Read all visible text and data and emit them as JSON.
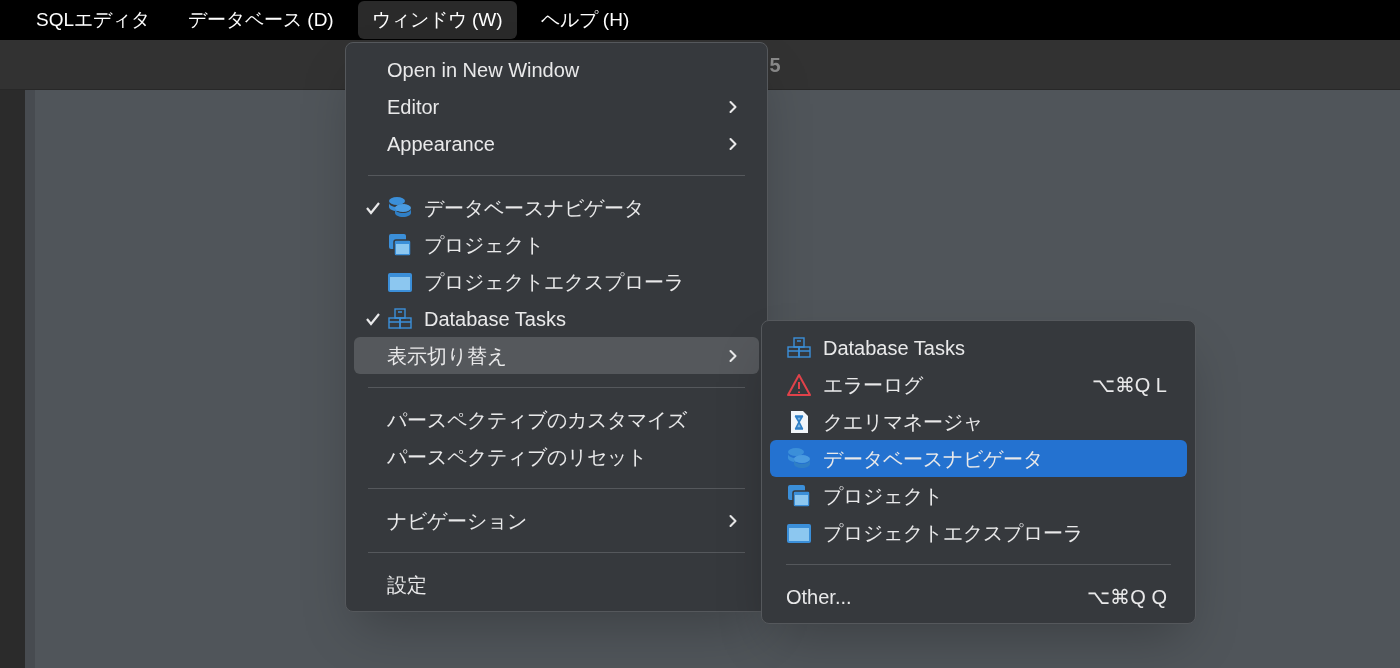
{
  "menu_bar": [
    {
      "label": "SQLエディタ",
      "selected": false
    },
    {
      "label": "データベース (D)",
      "selected": false
    },
    {
      "label": "ウィンドウ (W)",
      "selected": true
    },
    {
      "label": "ヘルプ (H)",
      "selected": false
    }
  ],
  "window": {
    "title": "5"
  },
  "window_menu": [
    {
      "kind": "text",
      "label": "Open in New Window",
      "checked": false,
      "selected": false,
      "submenu": false
    },
    {
      "kind": "text",
      "label": "Editor",
      "checked": false,
      "selected": false,
      "submenu": true
    },
    {
      "kind": "text",
      "label": "Appearance",
      "checked": false,
      "selected": false,
      "submenu": true
    },
    {
      "kind": "separator"
    },
    {
      "kind": "database",
      "label": "データベースナビゲータ",
      "checked": true,
      "selected": false,
      "submenu": false
    },
    {
      "kind": "windows",
      "label": "プロジェクト",
      "checked": false,
      "selected": false,
      "submenu": false
    },
    {
      "kind": "window",
      "label": "プロジェクトエクスプローラ",
      "checked": false,
      "selected": false,
      "submenu": false
    },
    {
      "kind": "boxes",
      "label": "Database Tasks",
      "checked": true,
      "selected": false,
      "submenu": false
    },
    {
      "kind": "text",
      "label": "表示切り替え",
      "checked": false,
      "selected": true,
      "submenu": true
    },
    {
      "kind": "separator"
    },
    {
      "kind": "text",
      "label": "パースペクティブのカスタマイズ",
      "checked": false,
      "selected": false,
      "submenu": false
    },
    {
      "kind": "text",
      "label": "パースペクティブのリセット",
      "checked": false,
      "selected": false,
      "submenu": false
    },
    {
      "kind": "separator"
    },
    {
      "kind": "text",
      "label": "ナビゲーション",
      "checked": false,
      "selected": false,
      "submenu": true
    },
    {
      "kind": "separator"
    },
    {
      "kind": "text",
      "label": "設定",
      "checked": false,
      "selected": false,
      "submenu": false
    }
  ],
  "show_view_submenu": [
    {
      "kind": "boxes",
      "label": "Database Tasks",
      "selected": false
    },
    {
      "kind": "warning",
      "label": "エラーログ",
      "shortcut": "⌥⌘Q L",
      "selected": false
    },
    {
      "kind": "hourglass",
      "label": "クエリマネージャ",
      "selected": false
    },
    {
      "kind": "database",
      "label": "データベースナビゲータ",
      "selected": true
    },
    {
      "kind": "windows",
      "label": "プロジェクト",
      "selected": false
    },
    {
      "kind": "window",
      "label": "プロジェクトエクスプローラ",
      "selected": false
    },
    {
      "kind": "separator"
    },
    {
      "kind": "text",
      "label": "Other...",
      "shortcut": "⌥⌘Q Q",
      "selected": false
    }
  ]
}
